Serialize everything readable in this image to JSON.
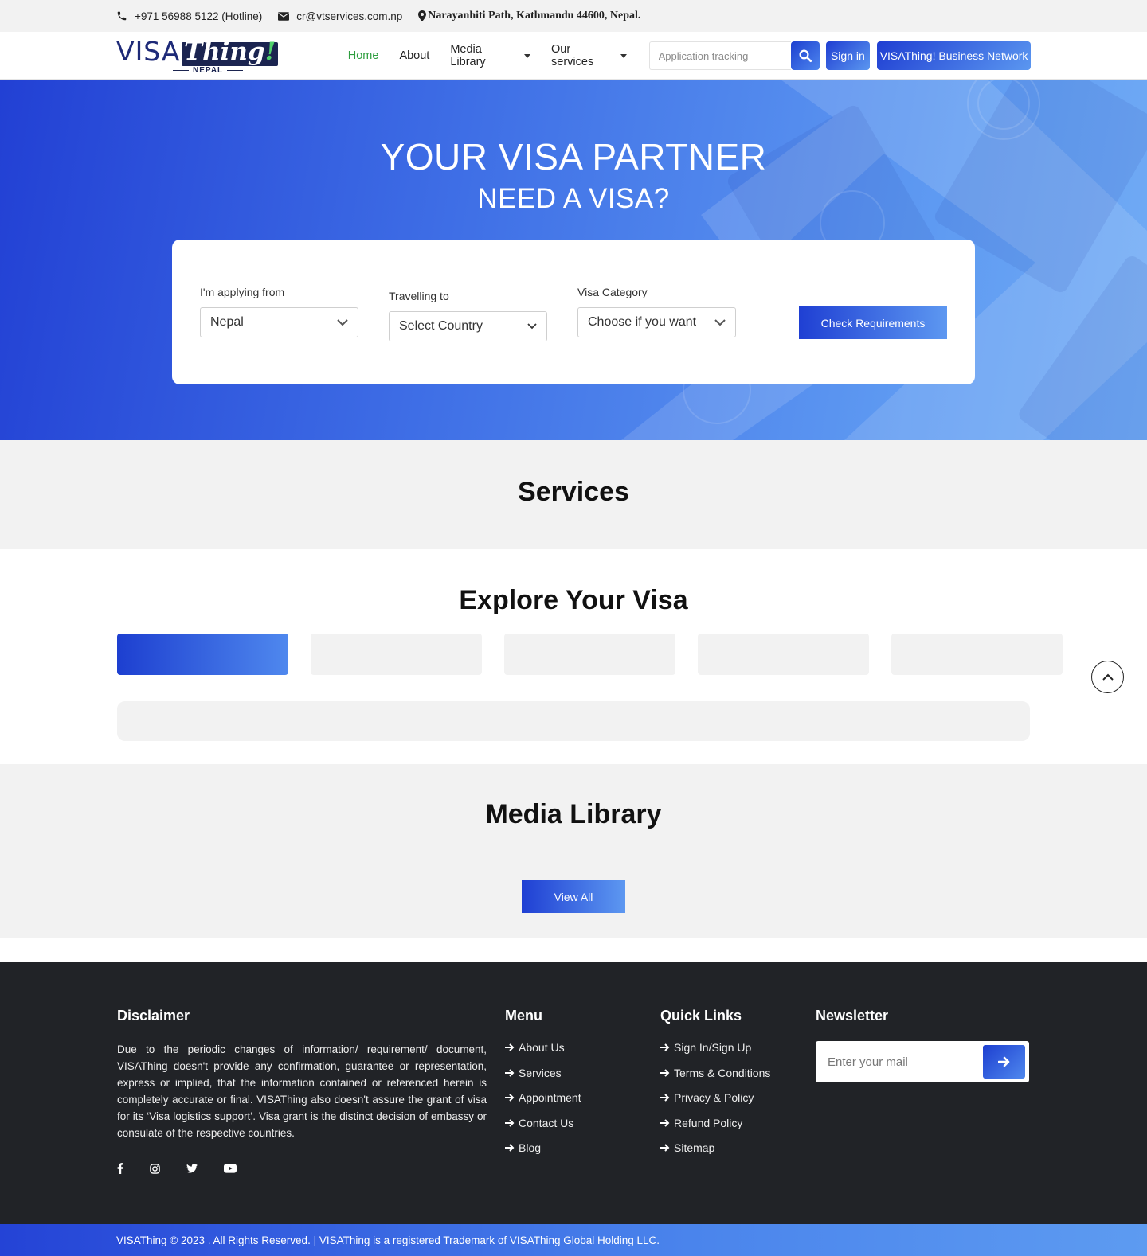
{
  "topbar": {
    "phone": "+971 56988 5122 (Hotline)",
    "email": "cr@vtservices.com.np",
    "address": "Narayanhiti Path, Kathmandu 44600, Nepal."
  },
  "logo": {
    "visa": "VISA",
    "thing": "Thing",
    "excl": "!",
    "country": "NEPAL"
  },
  "nav": {
    "items": [
      {
        "label": "Home",
        "active": true
      },
      {
        "label": "About"
      },
      {
        "label": "Media Library",
        "dropdown": true
      },
      {
        "label": "Our services",
        "dropdown": true
      }
    ],
    "tracking_placeholder": "Application tracking",
    "signin_label": "Sign in",
    "business_label": "VISAThing! Business Network"
  },
  "hero": {
    "title": "YOUR VISA PARTNER",
    "subtitle": "NEED A VISA?",
    "fields": {
      "from_label": "I'm applying from",
      "from_value": "Nepal",
      "to_label": "Travelling to",
      "to_value": "Select Country",
      "category_label": "Visa Category",
      "category_value": "Choose if you want"
    },
    "check_label": "Check Requirements"
  },
  "services": {
    "title": "Services"
  },
  "explore": {
    "title": "Explore Your Visa"
  },
  "media": {
    "title": "Media Library",
    "view_all": "View All"
  },
  "footer": {
    "disclaimer_title": "Disclaimer",
    "disclaimer_text": "Due to the periodic changes of information/ requirement/ document, VISAThing doesn't provide any confirmation, guarantee or representation, express or implied, that the information contained or referenced herein is completely accurate or final. VISAThing also doesn't assure the grant of visa for its ‘Visa logistics support’. Visa grant is the distinct decision of embassy or consulate of the respective countries.",
    "menu_title": "Menu",
    "menu": [
      "About Us",
      "Services",
      "Appointment",
      "Contact Us",
      "Blog"
    ],
    "quick_title": "Quick Links",
    "quick": [
      "Sign In/Sign Up",
      "Terms & Conditions",
      "Privacy & Policy",
      "Refund Policy",
      "Sitemap"
    ],
    "newsletter_title": "Newsletter",
    "newsletter_placeholder": "Enter your mail",
    "social": [
      "facebook-icon",
      "instagram-icon",
      "twitter-icon",
      "youtube-icon"
    ]
  },
  "copyright": "VISAThing © 2023 . All Rights Reserved. | VISAThing is a registered Trademark of VISAThing Global Holding LLC."
}
